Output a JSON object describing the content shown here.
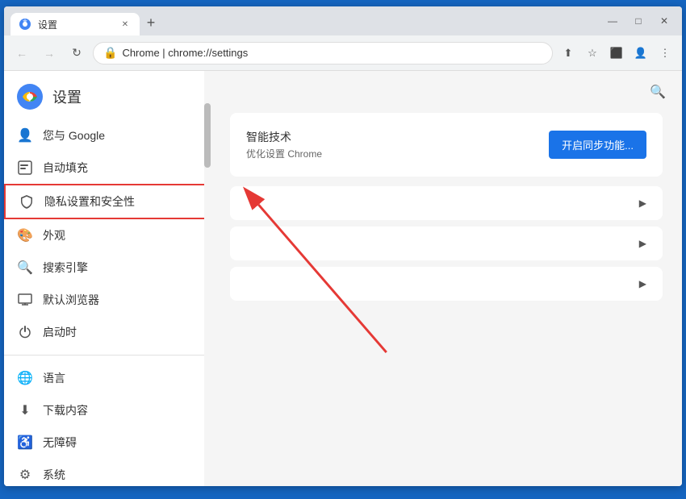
{
  "window": {
    "title": "设置",
    "tab_label": "设置",
    "new_tab_symbol": "+",
    "url_display": "Chrome | chrome://settings",
    "url_icon": "🔒",
    "url_text": "chrome://settings"
  },
  "controls": {
    "minimize": "—",
    "restore": "□",
    "close": "✕",
    "back": "←",
    "forward": "→",
    "refresh": "↻"
  },
  "addressbar": {
    "share_icon": "⬆",
    "bookmark_icon": "☆",
    "split_icon": "⬛",
    "profile_icon": "👤",
    "menu_icon": "⋮"
  },
  "sidebar": {
    "title": "设置",
    "items": [
      {
        "id": "google",
        "icon": "👤",
        "label": "您与 Google"
      },
      {
        "id": "autofill",
        "icon": "🗂",
        "label": "自动填充"
      },
      {
        "id": "privacy",
        "icon": "🛡",
        "label": "隐私设置和安全性",
        "highlighted": true
      },
      {
        "id": "appearance",
        "icon": "🎨",
        "label": "外观"
      },
      {
        "id": "search",
        "icon": "🔍",
        "label": "搜索引擎"
      },
      {
        "id": "browser",
        "icon": "🖥",
        "label": "默认浏览器"
      },
      {
        "id": "startup",
        "icon": "⏻",
        "label": "启动时"
      },
      {
        "id": "language",
        "icon": "🌐",
        "label": "语言"
      },
      {
        "id": "download",
        "icon": "⬇",
        "label": "下载内容"
      },
      {
        "id": "accessibility",
        "icon": "♿",
        "label": "无障碍"
      },
      {
        "id": "system",
        "icon": "⚙",
        "label": "系统"
      }
    ]
  },
  "main": {
    "sync_title": "智能技术",
    "sync_sub": "优化设置 Chrome",
    "sync_btn": "开启同步功能...",
    "list_items": [
      {
        "label": ""
      },
      {
        "label": ""
      },
      {
        "label": ""
      }
    ]
  }
}
